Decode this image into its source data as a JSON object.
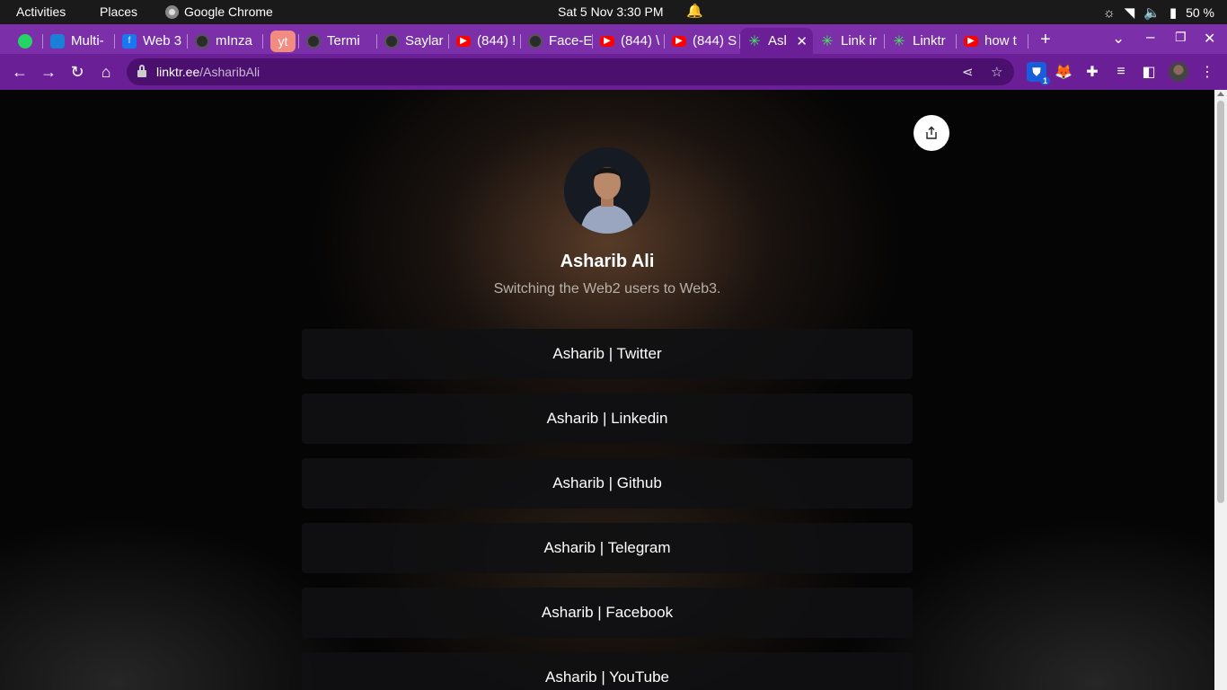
{
  "system_bar": {
    "activities": "Activities",
    "places": "Places",
    "app_name": "Google Chrome",
    "clock": "Sat 5 Nov  3:30 PM",
    "battery": "50 %"
  },
  "tabs": [
    {
      "title": "",
      "favicon": "whatsapp-icon"
    },
    {
      "title": "Multi-",
      "favicon": "q-icon"
    },
    {
      "title": "Web 3",
      "favicon": "facebook-icon"
    },
    {
      "title": "mInza",
      "favicon": "github-icon"
    },
    {
      "title": "yt",
      "favicon": "yt-pill"
    },
    {
      "title": "Termi",
      "favicon": "github-icon"
    },
    {
      "title": "Saylar",
      "favicon": "github-icon"
    },
    {
      "title": "(844) !",
      "favicon": "youtube-icon"
    },
    {
      "title": "Face-E",
      "favicon": "github-icon"
    },
    {
      "title": "(844) \\",
      "favicon": "youtube-icon"
    },
    {
      "title": "(844) S",
      "favicon": "youtube-icon"
    },
    {
      "title": "Asl",
      "favicon": "linktree-icon",
      "active": true,
      "close": "✕"
    },
    {
      "title": "Link ir",
      "favicon": "linktree-icon"
    },
    {
      "title": "Linktr",
      "favicon": "linktree-icon"
    },
    {
      "title": "how t",
      "favicon": "youtube-icon"
    }
  ],
  "address_bar": {
    "domain": "linktr.ee",
    "path": "/AsharibAli"
  },
  "extensions": {
    "bitwarden_badge": "1"
  },
  "profile": {
    "name": "Asharib Ali",
    "bio": "Switching the Web2 users to Web3."
  },
  "links": [
    {
      "label": "Asharib | Twitter"
    },
    {
      "label": "Asharib | Linkedin"
    },
    {
      "label": "Asharib | Github"
    },
    {
      "label": "Asharib | Telegram"
    },
    {
      "label": "Asharib | Facebook"
    },
    {
      "label": "Asharib | YouTube"
    }
  ],
  "colors": {
    "tab_strip": "#7b2fa8",
    "toolbar": "#6a1f96",
    "omnibox": "#4b0f6e",
    "link_button": "#101012"
  }
}
